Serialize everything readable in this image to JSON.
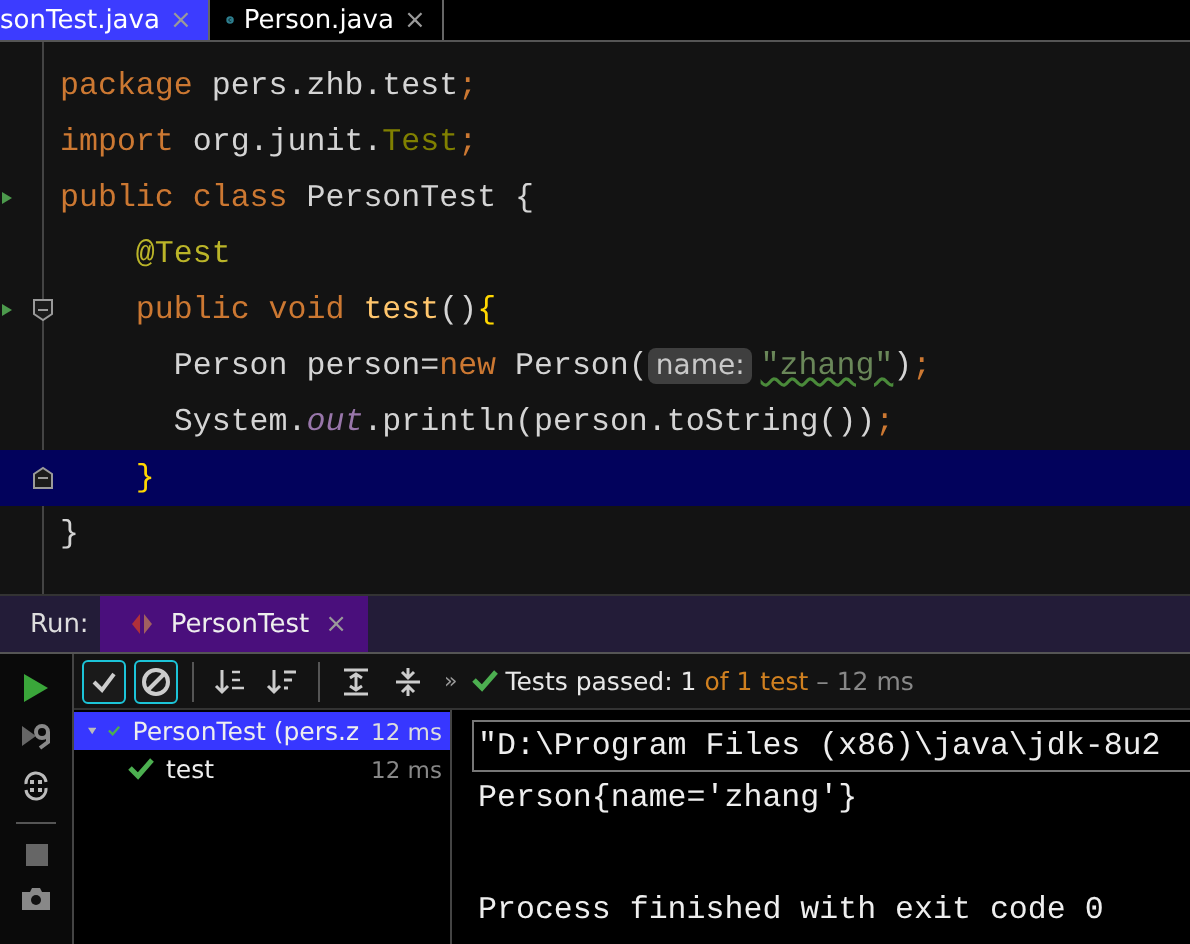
{
  "editor_tabs": [
    {
      "label": "sonTest.java",
      "selected": true,
      "close": "×",
      "icon": false
    },
    {
      "label": "Person.java",
      "selected": false,
      "close": "×",
      "icon": true
    }
  ],
  "code": [
    {
      "current": false,
      "run_marker": false,
      "fold": false,
      "tokens": [
        {
          "kind": "kw",
          "text": "package "
        },
        {
          "kind": "plain",
          "text": "pers.zhb.test"
        },
        {
          "kind": "kw",
          "text": ";"
        }
      ]
    },
    {
      "current": false,
      "run_marker": false,
      "fold": false,
      "tokens": [
        {
          "kind": "kw",
          "text": "import "
        },
        {
          "kind": "plain",
          "text": "org.junit."
        },
        {
          "kind": "type",
          "text": "Test"
        },
        {
          "kind": "kw",
          "text": ";"
        }
      ]
    },
    {
      "current": false,
      "run_marker": true,
      "fold": false,
      "tokens": [
        {
          "kind": "kw",
          "text": "public class "
        },
        {
          "kind": "plain",
          "text": "PersonTest {"
        }
      ]
    },
    {
      "current": false,
      "run_marker": false,
      "fold": false,
      "tokens": [
        {
          "kind": "annotation",
          "text": "    @Test"
        }
      ]
    },
    {
      "current": false,
      "run_marker": true,
      "fold": true,
      "tokens": [
        {
          "kind": "kw",
          "text": "    public void "
        },
        {
          "kind": "method",
          "text": "test"
        },
        {
          "kind": "plain",
          "text": "()"
        },
        {
          "kind": "brace",
          "text": "{"
        }
      ]
    },
    {
      "current": false,
      "run_marker": false,
      "fold": false,
      "tokens": [
        {
          "kind": "plain",
          "text": "      Person person="
        },
        {
          "kind": "kw",
          "text": "new "
        },
        {
          "kind": "plain",
          "text": "Person("
        },
        {
          "kind": "hint",
          "text": "name:"
        },
        {
          "kind": "string",
          "text": "\"zhang\""
        },
        {
          "kind": "plain",
          "text": ")"
        },
        {
          "kind": "kw",
          "text": ";"
        }
      ]
    },
    {
      "current": false,
      "run_marker": false,
      "fold": false,
      "tokens": [
        {
          "kind": "plain",
          "text": "      System."
        },
        {
          "kind": "static",
          "text": "out"
        },
        {
          "kind": "plain",
          "text": ".println(person.toString())"
        },
        {
          "kind": "kw",
          "text": ";"
        }
      ]
    },
    {
      "current": true,
      "run_marker": false,
      "fold": true,
      "tokens": [
        {
          "kind": "brace",
          "text": "    }"
        }
      ]
    },
    {
      "current": false,
      "run_marker": false,
      "fold": false,
      "tokens": [
        {
          "kind": "plain",
          "text": "}"
        }
      ]
    }
  ],
  "run_panel": {
    "label": "Run:",
    "tabs": [
      {
        "label": "PersonTest",
        "selected": true,
        "close": "×"
      }
    ],
    "toolbar": [
      {
        "kind": "check",
        "on": true
      },
      {
        "kind": "ban",
        "on": true
      },
      {
        "kind": "sort-alpha",
        "on": false
      },
      {
        "kind": "sort-duration",
        "on": false
      },
      {
        "kind": "expand",
        "on": false
      },
      {
        "kind": "collapse",
        "on": false
      }
    ],
    "more": "»",
    "status": [
      {
        "kind": "plain",
        "text": "Tests passed: "
      },
      {
        "kind": "plain",
        "text": "1"
      },
      {
        "kind": "accent",
        "text": " of 1 test"
      },
      {
        "kind": "muted",
        "text": " – 12 ms"
      }
    ],
    "tree": [
      {
        "label": "PersonTest (pers.z",
        "time": "12 ms",
        "selected": true,
        "expanded": true,
        "children": [
          {
            "label": "test",
            "time": "12 ms",
            "selected": false
          }
        ]
      }
    ],
    "console": [
      {
        "kind": "command",
        "text": "\"D:\\Program Files (x86)\\java\\jdk-8u2"
      },
      {
        "kind": "output",
        "text": "Person{name='zhang'}"
      },
      {
        "kind": "exit",
        "text": "Process finished with exit code 0"
      }
    ]
  }
}
